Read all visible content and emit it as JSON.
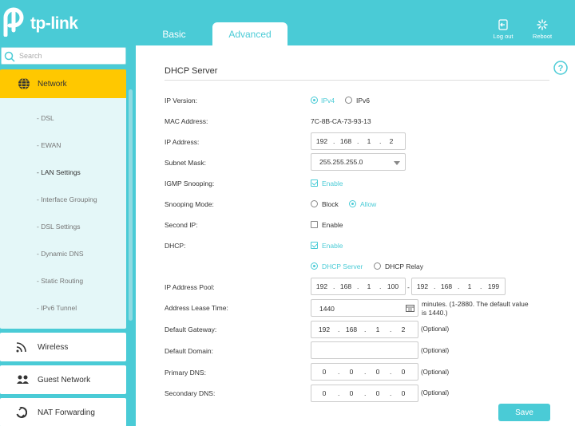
{
  "header": {
    "logo_text": "tp-link",
    "tabs": [
      {
        "label": "Basic"
      },
      {
        "label": "Advanced"
      }
    ],
    "logout_label": "Log out",
    "reboot_label": "Reboot"
  },
  "sidebar": {
    "search_placeholder": "Search",
    "active_item": "Network",
    "subitems": [
      "- DSL",
      "- EWAN",
      "- LAN Settings",
      "- Interface Grouping",
      "- DSL Settings",
      "- Dynamic DNS",
      "- Static Routing",
      "- IPv6 Tunnel"
    ],
    "items": [
      {
        "label": "Wireless"
      },
      {
        "label": "Guest Network"
      },
      {
        "label": "NAT Forwarding"
      }
    ]
  },
  "content": {
    "title": "DHCP Server",
    "labels": {
      "ip_version": "IP Version:",
      "mac": "MAC Address:",
      "ip_address": "IP Address:",
      "subnet": "Subnet Mask:",
      "igmp": "IGMP Snooping:",
      "snooping_mode": "Snooping Mode:",
      "second_ip": "Second IP:",
      "dhcp": "DHCP:",
      "pool": "IP Address Pool:",
      "lease": "Address Lease Time:",
      "gateway": "Default Gateway:",
      "domain": "Default Domain:",
      "pdns": "Primary DNS:",
      "sdns": "Secondary DNS:"
    },
    "ipv4": "IPv4",
    "ipv6": "IPv6",
    "mac_value": "7C-8B-CA-73-93-13",
    "ip_octets": [
      "192",
      "168",
      "1",
      "2"
    ],
    "subnet_value": "255.255.255.0",
    "enable": "Enable",
    "block": "Block",
    "allow": "Allow",
    "dhcp_server": "DHCP Server",
    "dhcp_relay": "DHCP Relay",
    "pool_start": [
      "192",
      "168",
      "1",
      "100"
    ],
    "pool_end": [
      "192",
      "168",
      "1",
      "199"
    ],
    "pool_sep": "-",
    "lease_value": "1440",
    "lease_note": "minutes. (1-2880. The default value is 1440.)",
    "gateway_octets": [
      "192",
      "168",
      "1",
      "2"
    ],
    "domain_value": "",
    "pdns_octets": [
      "0",
      "0",
      "0",
      "0"
    ],
    "sdns_octets": [
      "0",
      "0",
      "0",
      "0"
    ],
    "optional": "(Optional)",
    "save": "Save"
  }
}
